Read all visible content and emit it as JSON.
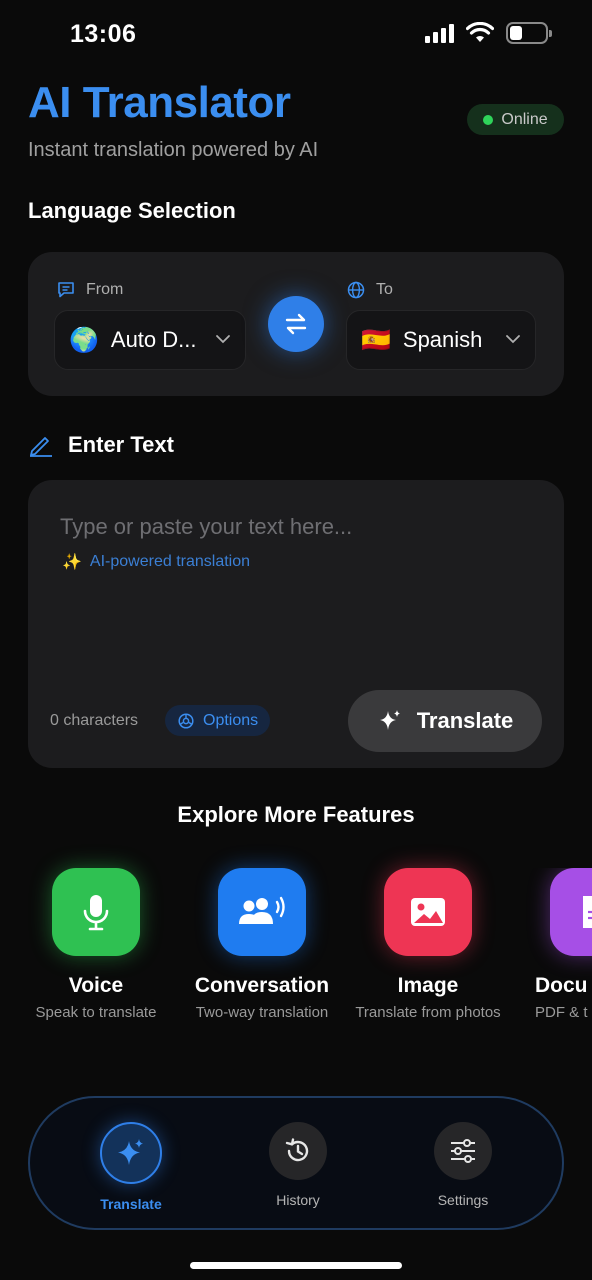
{
  "status_bar": {
    "time": "13:06",
    "battery_level": 0.35
  },
  "header": {
    "title": "AI Translator",
    "subtitle": "Instant translation powered by AI",
    "status_badge": "Online",
    "status_color": "#2fd35a"
  },
  "language_section": {
    "title": "Language Selection",
    "from": {
      "label": "From",
      "selected": "Auto D...",
      "flag": "🌍",
      "icon": "chat-bubble-icon"
    },
    "to": {
      "label": "To",
      "selected": "Spanish",
      "flag": "🇪🇸",
      "icon": "globe-icon"
    },
    "swap_icon": "swap-arrows-icon"
  },
  "text_section": {
    "title": "Enter Text",
    "placeholder": "Type or paste your text here...",
    "value": "",
    "ai_hint": "AI-powered translation",
    "ai_hint_emoji": "✨",
    "char_count": "0 characters",
    "options_label": "Options",
    "translate_label": "Translate"
  },
  "features": {
    "title": "Explore More Features",
    "items": [
      {
        "name": "Voice",
        "desc": "Speak to translate",
        "icon": "microphone-icon",
        "color": "#2fc152"
      },
      {
        "name": "Conversation",
        "desc": "Two-way translation",
        "icon": "people-speaking-icon",
        "color": "#1f7cf0"
      },
      {
        "name": "Image",
        "desc": "Translate from photos",
        "icon": "photo-icon",
        "color": "#ee3554"
      },
      {
        "name": "Docu",
        "desc": "PDF & t",
        "icon": "document-icon",
        "color": "#a64fe6"
      }
    ]
  },
  "bottom_nav": {
    "items": [
      {
        "label": "Translate",
        "icon": "sparkle-icon",
        "active": true
      },
      {
        "label": "History",
        "icon": "history-icon",
        "active": false
      },
      {
        "label": "Settings",
        "icon": "sliders-icon",
        "active": false
      }
    ]
  },
  "colors": {
    "accent": "#3b8ef0",
    "background": "#0a0a0a",
    "card": "#1c1c1e"
  }
}
